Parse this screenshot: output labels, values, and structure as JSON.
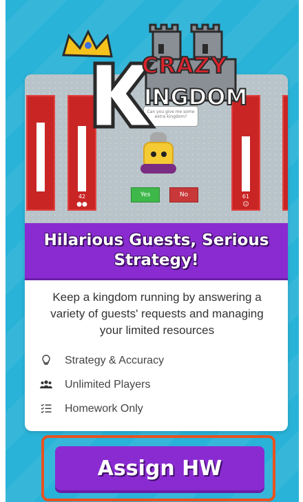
{
  "logo": {
    "text_top": "CRAZY",
    "text_bottom": "KINGDOM"
  },
  "game_preview": {
    "speech_text": "Can you give me some extra kingdom?",
    "bars": [
      {
        "value": "",
        "fill_percent": 60
      },
      {
        "value": "42",
        "fill_percent": 55,
        "icon": "users-icon"
      },
      {
        "value": "61",
        "fill_percent": 45,
        "icon": "smile-icon"
      },
      {
        "value": "",
        "fill_percent": 55
      }
    ],
    "yes_label": "Yes",
    "no_label": "No"
  },
  "banner": {
    "title": "Hilarious Guests, Serious Strategy!"
  },
  "description": "Keep a kingdom running by answering a variety of guests' requests and managing your limited resources",
  "features": [
    {
      "icon": "lightbulb-icon",
      "label": "Strategy & Accuracy"
    },
    {
      "icon": "users-icon",
      "label": "Unlimited Players"
    },
    {
      "icon": "checklist-icon",
      "label": "Homework Only"
    }
  ],
  "cta": {
    "label": "Assign HW"
  },
  "colors": {
    "background": "#29b3d8",
    "accent": "#8a2bd1",
    "highlight": "#e8521f",
    "bar": "#c92525",
    "yes": "#3db849",
    "no": "#c83838"
  }
}
